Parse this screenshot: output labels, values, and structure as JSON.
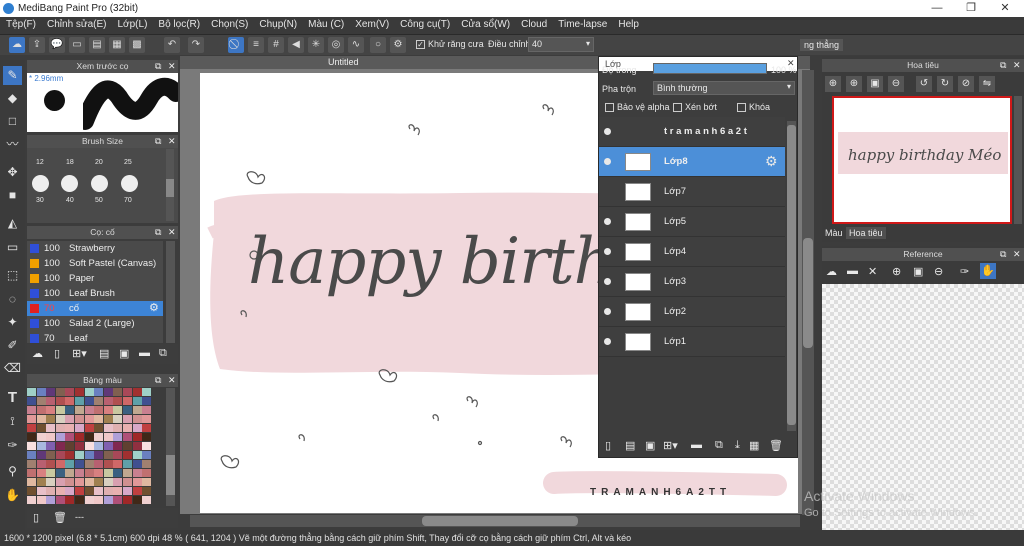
{
  "app": {
    "title": "MediBang Paint Pro (32bit)",
    "window_controls": [
      "—",
      "❐",
      "✕"
    ]
  },
  "menu": [
    "Tệp(F)",
    "Chỉnh sửa(E)",
    "Lớp(L)",
    "Bộ lọc(R)",
    "Chọn(S)",
    "Chụp(N)",
    "Màu (C)",
    "Xem(V)",
    "Công cụ(T)",
    "Cửa sổ(W)",
    "Cloud",
    "Time-lapse",
    "Help"
  ],
  "toolbar": {
    "antialias_label": "Khử răng cưa",
    "adjust_label": "Điều chỉnh",
    "adjust_value": "40",
    "straight_label": "ng thẳng"
  },
  "preview_panel": {
    "title": "Xem trước cọ",
    "size": "* 2.96mm"
  },
  "brush_size_panel": {
    "title": "Brush Size",
    "sizes": [
      "12",
      "18",
      "20",
      "25",
      "30",
      "40",
      "50",
      "70"
    ]
  },
  "brush_panel": {
    "title": "Cọ: cố",
    "brushes": [
      {
        "size": "100",
        "name": "Strawberry",
        "color": "#2f4fd8"
      },
      {
        "size": "100",
        "name": "Soft Pastel (Canvas)",
        "color": "#f0a000"
      },
      {
        "size": "100",
        "name": "Paper",
        "color": "#f0a000"
      },
      {
        "size": "100",
        "name": "Leaf Brush",
        "color": "#2f4fd8"
      },
      {
        "size": "70",
        "name": "cố",
        "color": "#e02020",
        "selected": true
      },
      {
        "size": "100",
        "name": "Salad 2 (Large)",
        "color": "#2f4fd8"
      },
      {
        "size": "70",
        "name": "Leaf",
        "color": "#2f4fd8"
      }
    ]
  },
  "palette_panel": {
    "title": "Bảng màu",
    "more": "---"
  },
  "canvas": {
    "tab": "Untitled",
    "text_main": "happy birthday",
    "text_small": "TRAMANH6A2TT",
    "watermark_1": "Activate Windows",
    "watermark_2": "Go to Settings to activate Windows."
  },
  "layers": {
    "title": "Lớp",
    "opacity_label": "Độ trong",
    "opacity_value": "100 %",
    "opacity": 1.0,
    "blend_label": "Pha trộn",
    "blend_value": "Bình thường",
    "protect_alpha": "Bảo vệ alpha",
    "clipping": "Xén bớt",
    "lock": "Khóa",
    "items": [
      {
        "name": "t r a m a n h 6 a 2 t",
        "visible": true,
        "selected": false
      },
      {
        "name": "Lớp8",
        "visible": true,
        "selected": true
      },
      {
        "name": "Lớp7",
        "visible": false,
        "selected": false
      },
      {
        "name": "Lớp5",
        "visible": true,
        "selected": false
      },
      {
        "name": "Lớp4",
        "visible": true,
        "selected": false
      },
      {
        "name": "Lớp3",
        "visible": true,
        "selected": false
      },
      {
        "name": "Lớp2",
        "visible": true,
        "selected": false
      },
      {
        "name": "Lớp1",
        "visible": true,
        "selected": false
      }
    ]
  },
  "navigator": {
    "title": "Hoa tiêu",
    "preview_text": "happy birthday Méo",
    "tabs": [
      "Màu",
      "Hoa tiêu"
    ]
  },
  "reference": {
    "title": "Reference"
  },
  "status": {
    "size": "1600 * 1200 pixel",
    "physical": "(6.8 * 5.1cm)",
    "dpi": "600 dpi",
    "zoom": "48 %",
    "coords": "( 641, 1204 )",
    "hint": "Vẽ một đường thẳng bằng cách giữ phím Shift, Thay đổi cỡ cọ bằng cách giữ phím Ctrl, Alt và kéo"
  },
  "colors": {
    "accent": "#4a90d9",
    "bg": "#3c3c3c",
    "panel": "#4a4a4a",
    "blush": "#f1d8dc",
    "ink": "#4a4a4a"
  }
}
